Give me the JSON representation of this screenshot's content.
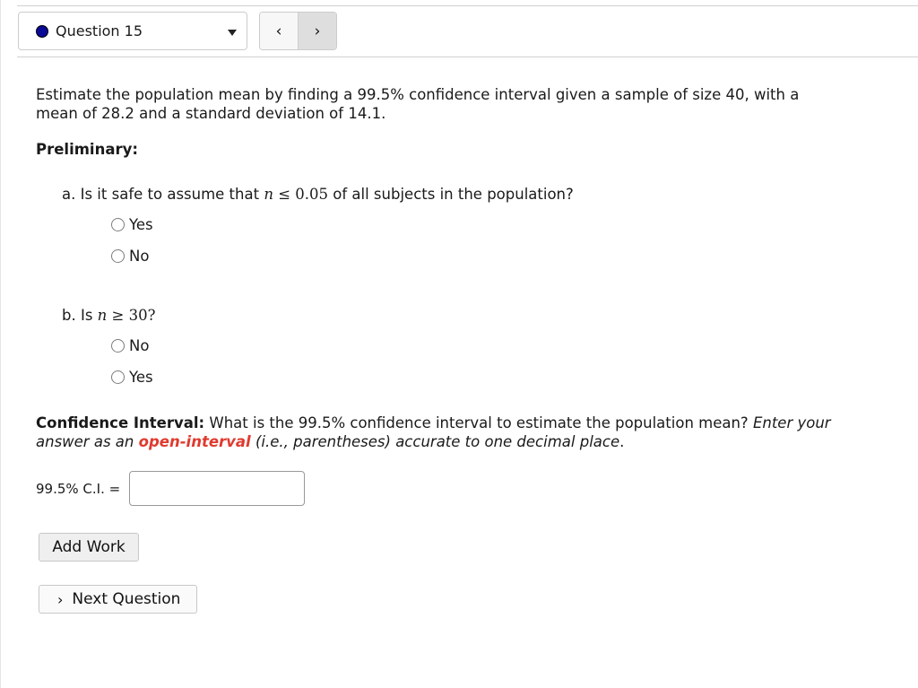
{
  "header": {
    "question_select": {
      "label": "Question 15",
      "status_color": "#0a0a96"
    },
    "nav": {
      "prev_icon": "‹",
      "next_icon": "›"
    }
  },
  "problem": {
    "intro": "Estimate the population mean by finding a 99.5% confidence interval given a sample of size 40, with a mean of 28.2 and a standard deviation of 14.1.",
    "preliminary_heading": "Preliminary:",
    "part_a": {
      "prefix": "a. Is it safe to assume that ",
      "math_var": "n",
      "math_rel": " ≤ 0.05",
      "suffix": " of all subjects in the population?",
      "options": [
        "Yes",
        "No"
      ]
    },
    "part_b": {
      "prefix": "b. Is ",
      "math_var": "n",
      "math_rel": " ≥ 30?",
      "options": [
        "No",
        "Yes"
      ]
    },
    "confidence_interval": {
      "heading": "Confidence Interval:",
      "question": " What is the 99.5% confidence interval to estimate the population mean? ",
      "instruction_a": "Enter your answer as an ",
      "highlight": "open-interval",
      "instruction_b": " (i.e., parentheses) accurate to one decimal place",
      "period": ".",
      "highlight_color": "#e03a2f"
    },
    "answer": {
      "label": "99.5% C.I. =",
      "value": "",
      "placeholder": ""
    }
  },
  "buttons": {
    "add_work": "Add Work",
    "next_question": "Next Question",
    "next_question_icon": "›"
  }
}
